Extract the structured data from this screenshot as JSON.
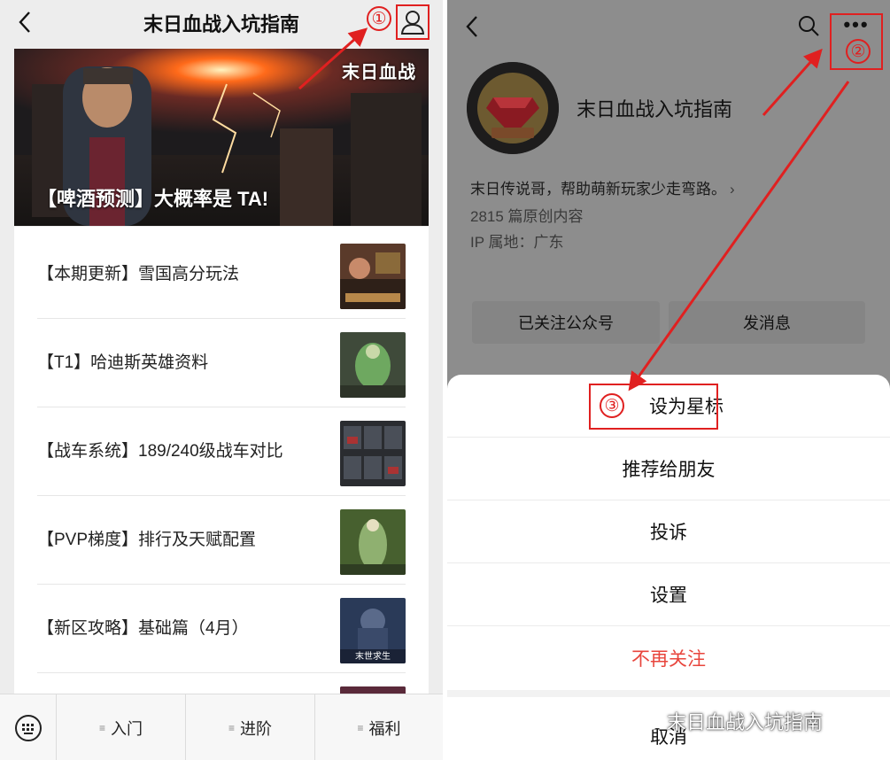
{
  "left": {
    "nav": {
      "title": "末日血战入坑指南",
      "back_icon": "chevron-left-icon",
      "profile_icon": "person-icon"
    },
    "step1": "①",
    "banner": {
      "caption": "【啤酒预测】大概率是 TA!",
      "logo": "末日血战"
    },
    "articles": [
      {
        "title": "【本期更新】雪国高分玩法"
      },
      {
        "title": "【T1】哈迪斯英雄资料"
      },
      {
        "title": "【战车系统】189/240级战车对比"
      },
      {
        "title": "【PVP梯度】排行及天赋配置"
      },
      {
        "title": "【新区攻略】基础篇（4月）",
        "thumb_text": "末世求生"
      }
    ],
    "menu": {
      "keyboard_icon": "keyboard-icon",
      "items": [
        {
          "label": "入门"
        },
        {
          "label": "进阶"
        },
        {
          "label": "福利"
        }
      ]
    }
  },
  "right": {
    "step2": "②",
    "more": "•••",
    "account": {
      "name": "末日血战入坑指南",
      "description": "末日传说哥，帮助萌新玩家少走弯路。",
      "desc_chevron": "›",
      "original_count": "2815 篇原创内容",
      "ip_location": "IP 属地：广东"
    },
    "buttons": {
      "followed": "已关注公众号",
      "message": "发消息"
    },
    "sheet": {
      "step3": "③",
      "items": [
        {
          "label": "设为星标"
        },
        {
          "label": "推荐给朋友"
        },
        {
          "label": "投诉"
        },
        {
          "label": "设置"
        },
        {
          "label": "不再关注"
        }
      ],
      "cancel": "取消"
    },
    "watermark": "末日血战入坑指南"
  },
  "colors": {
    "annotation": "#e02020",
    "danger": "#e8453c",
    "overlay": "#8d8d8d"
  }
}
